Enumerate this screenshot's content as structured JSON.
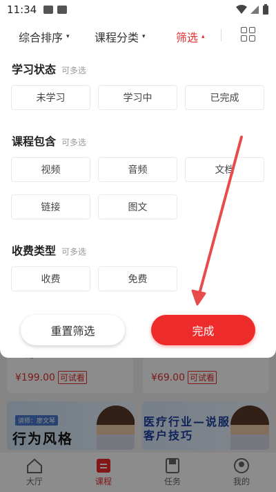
{
  "status_bar": {
    "time": "11:34"
  },
  "filter_tabs": [
    {
      "label": "综合排序",
      "caret": "▾"
    },
    {
      "label": "课程分类",
      "caret": "▾"
    },
    {
      "label": "筛选",
      "caret": "▴"
    }
  ],
  "sections": [
    {
      "title": "学习状态",
      "hint": "可多选",
      "chips": [
        "未学习",
        "学习中",
        "已完成"
      ]
    },
    {
      "title": "课程包含",
      "hint": "可多选",
      "chips": [
        "视频",
        "音频",
        "文档",
        "链接",
        "图文"
      ]
    },
    {
      "title": "收费类型",
      "hint": "可多选",
      "chips": [
        "收费",
        "免费"
      ]
    }
  ],
  "buttons": {
    "reset": "重置筛选",
    "done": "完成"
  },
  "background": {
    "cards": [
      {
        "price": "¥199.00",
        "badge": "可试看"
      },
      {
        "price": "¥69.00",
        "badge": "可试看"
      }
    ],
    "thumbs": [
      {
        "text": "行为风格",
        "tag": "讲师：廖文琴"
      },
      {
        "text": "医疗行业—说服客户技巧"
      }
    ],
    "fragment": "キ》"
  },
  "bottom_nav": [
    {
      "label": "大厅",
      "icon": "house-icon"
    },
    {
      "label": "课程",
      "icon": "course-icon"
    },
    {
      "label": "任务",
      "icon": "task-icon"
    },
    {
      "label": "我的",
      "icon": "profile-icon"
    }
  ],
  "colors": {
    "accent": "#ee2b2b",
    "annotation_arrow": "#e84b4b"
  }
}
